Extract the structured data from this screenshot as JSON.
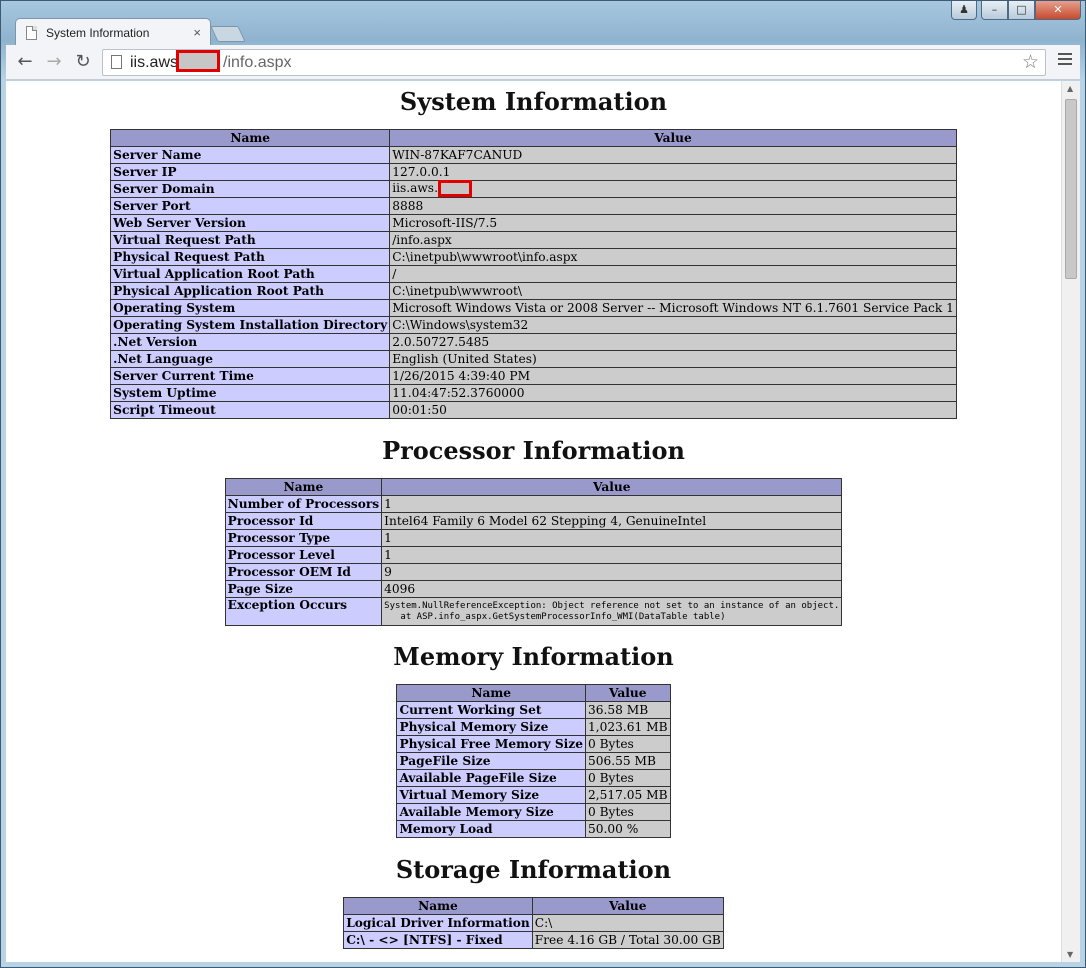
{
  "browser": {
    "tab_title": "System Information",
    "tab_close": "×",
    "url_visible_prefix": "iis.aws",
    "url_visible_suffix": "/info.aspx",
    "back": "←",
    "forward": "→",
    "reload": "↻",
    "star": "☆",
    "win_min": "–",
    "win_max": "□",
    "win_close": "✕",
    "win_user": "♟"
  },
  "system": {
    "heading": "System Information",
    "col_name": "Name",
    "col_value": "Value",
    "rows": [
      {
        "name": "Server Name",
        "value": "WIN-87KAF7CANUD"
      },
      {
        "name": "Server IP",
        "value": "127.0.0.1"
      },
      {
        "name": "Server Domain",
        "value": "iis.aws."
      },
      {
        "name": "Server Port",
        "value": "8888"
      },
      {
        "name": "Web Server Version",
        "value": "Microsoft-IIS/7.5"
      },
      {
        "name": "Virtual Request Path",
        "value": "/info.aspx"
      },
      {
        "name": "Physical Request Path",
        "value": "C:\\inetpub\\wwwroot\\info.aspx"
      },
      {
        "name": "Virtual Application Root Path",
        "value": "/"
      },
      {
        "name": "Physical Application Root Path",
        "value": "C:\\inetpub\\wwwroot\\"
      },
      {
        "name": "Operating System",
        "value": "Microsoft Windows Vista or 2008 Server -- Microsoft Windows NT 6.1.7601 Service Pack 1"
      },
      {
        "name": "Operating System Installation Directory",
        "value": "C:\\Windows\\system32"
      },
      {
        "name": ".Net Version",
        "value": "2.0.50727.5485"
      },
      {
        "name": ".Net Language",
        "value": "English (United States)"
      },
      {
        "name": "Server Current Time",
        "value": "1/26/2015 4:39:40 PM"
      },
      {
        "name": "System Uptime",
        "value": "11.04:47:52.3760000"
      },
      {
        "name": "Script Timeout",
        "value": "00:01:50"
      }
    ]
  },
  "processor": {
    "heading": "Processor Information",
    "col_name": "Name",
    "col_value": "Value",
    "rows": [
      {
        "name": "Number of Processors",
        "value": "1"
      },
      {
        "name": "Processor Id",
        "value": "Intel64 Family 6 Model 62 Stepping 4, GenuineIntel"
      },
      {
        "name": "Processor Type",
        "value": "1"
      },
      {
        "name": "Processor Level",
        "value": "1"
      },
      {
        "name": "Processor OEM Id",
        "value": "9"
      },
      {
        "name": "Page Size",
        "value": "4096"
      }
    ],
    "exception_name": "Exception Occurs",
    "exception_text": "System.NullReferenceException: Object reference not set to an instance of an object.\n   at ASP.info_aspx.GetSystemProcessorInfo_WMI(DataTable table)"
  },
  "memory": {
    "heading": "Memory Information",
    "col_name": "Name",
    "col_value": "Value",
    "rows": [
      {
        "name": "Current Working Set",
        "value": "36.58 MB"
      },
      {
        "name": "Physical Memory Size",
        "value": "1,023.61 MB"
      },
      {
        "name": "Physical Free Memory Size",
        "value": "0 Bytes"
      },
      {
        "name": "PageFile Size",
        "value": "506.55 MB"
      },
      {
        "name": "Available PageFile Size",
        "value": "0 Bytes"
      },
      {
        "name": "Virtual Memory Size",
        "value": "2,517.05 MB"
      },
      {
        "name": "Available Memory Size",
        "value": "0 Bytes"
      },
      {
        "name": "Memory Load",
        "value": "50.00 %"
      }
    ]
  },
  "storage": {
    "heading": "Storage Information",
    "col_name": "Name",
    "col_value": "Value",
    "rows": [
      {
        "name": "Logical Driver Information",
        "value": "C:\\"
      },
      {
        "name": "C:\\ - <> [NTFS] - Fixed",
        "value": "Free 4.16 GB / Total 30.00 GB"
      }
    ]
  }
}
